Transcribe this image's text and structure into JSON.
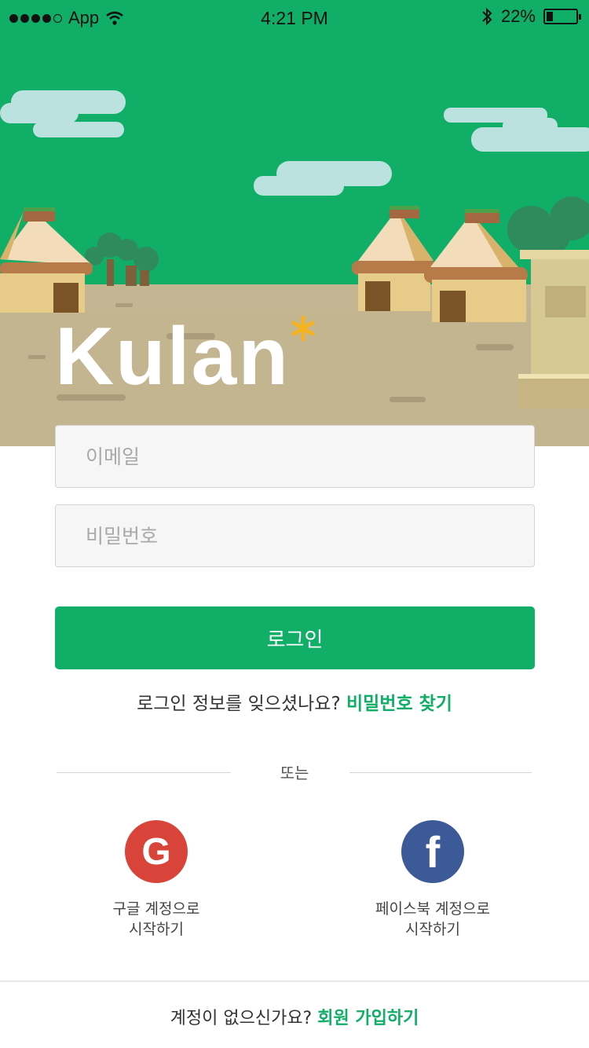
{
  "status_bar": {
    "carrier": "App",
    "time": "4:21 PM",
    "battery": "22%",
    "battery_level": 0.22,
    "signal_bars": 4
  },
  "brand": {
    "logo_text": "Kulan",
    "colors": {
      "primary": "#11ae68",
      "google": "#d9443a",
      "facebook": "#3c5998",
      "sky_cloud": "#bce2e0",
      "ground": "#c4b693"
    }
  },
  "form": {
    "email_placeholder": "이메일",
    "password_placeholder": "비밀번호",
    "login_label": "로그인"
  },
  "forgot": {
    "text": "로그인 정보를 잊으셨나요?",
    "link": "비밀번호 찾기"
  },
  "divider_label": "또는",
  "social": {
    "google": {
      "icon": "G",
      "line1": "구글 계정으로",
      "line2": "시작하기"
    },
    "facebook": {
      "icon": "f",
      "line1": "페이스북 계정으로",
      "line2": "시작하기"
    }
  },
  "signup": {
    "text": "계정이 없으신가요?",
    "link": "회원 가입하기"
  }
}
